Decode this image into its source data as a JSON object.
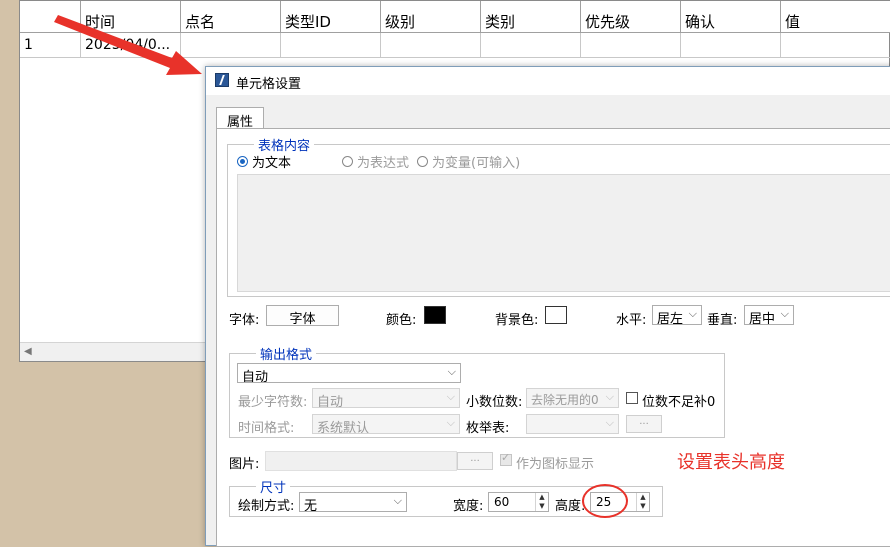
{
  "grid": {
    "columns": [
      "时间",
      "点名",
      "类型ID",
      "级别",
      "类别",
      "优先级",
      "确认",
      "值"
    ],
    "rows": [
      {
        "index": "1",
        "time": "2025/04/0..."
      }
    ]
  },
  "dialog": {
    "title": "单元格设置",
    "tab": "属性",
    "content_group": {
      "legend": "表格内容",
      "radio_text": "为文本",
      "radio_expr": "为表达式",
      "radio_var": "为变量(可输入)",
      "selected": "为文本"
    },
    "font": {
      "label": "字体:",
      "button": "字体"
    },
    "color": {
      "label": "颜色:",
      "value": "#000000"
    },
    "bgcolor": {
      "label": "背景色:",
      "value": "#ffffff"
    },
    "halign": {
      "label": "水平:",
      "value": "居左"
    },
    "valign": {
      "label": "垂直:",
      "value": "居中"
    },
    "output": {
      "legend": "输出格式",
      "format": "自动",
      "min_chars_label": "最少字符数:",
      "min_chars": "自动",
      "decimal_label": "小数位数:",
      "decimal": "去除无用的0",
      "pad_label": "位数不足补0",
      "time_label": "时间格式:",
      "time": "系统默认",
      "enum_label": "枚举表:",
      "enum": "",
      "enum_btn": "..."
    },
    "image": {
      "label": "图片:",
      "btn": "...",
      "as_icon": "作为图标显示"
    },
    "size": {
      "legend": "尺寸",
      "draw_label": "绘制方式:",
      "draw": "无",
      "width_label": "宽度:",
      "width": "60",
      "height_label": "高度:",
      "height": "25"
    }
  },
  "annotation": {
    "text": "设置表头高度",
    "color": "#e8322a"
  }
}
